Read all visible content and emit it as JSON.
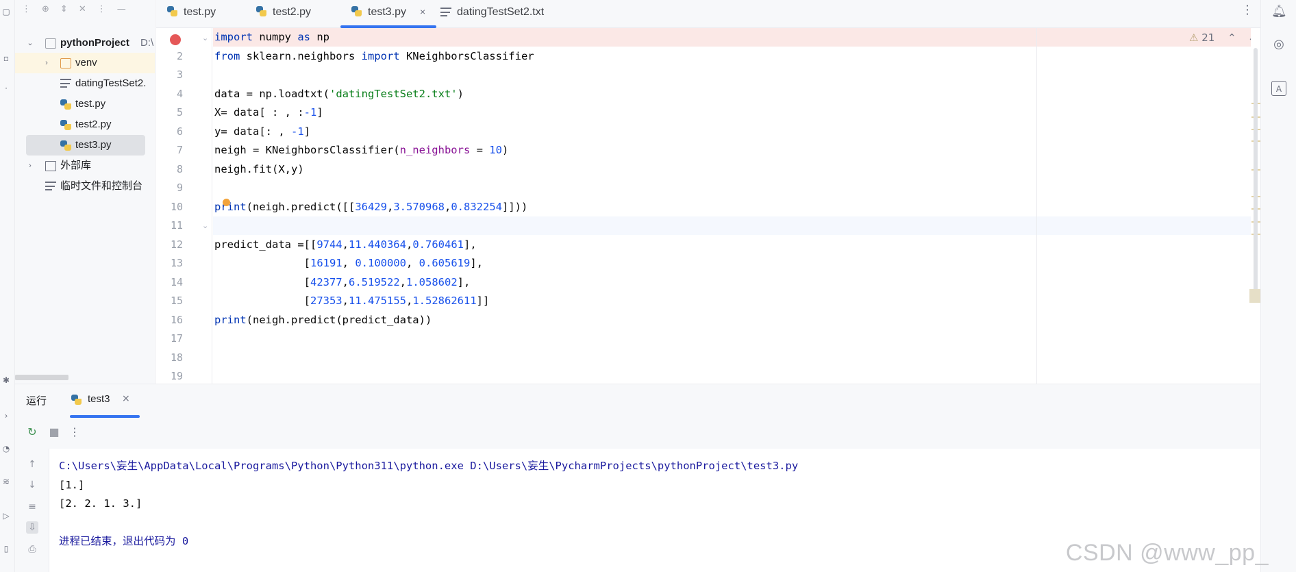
{
  "project_panel": {
    "toolbar_icons": [
      "ellipsis-icon",
      "target-icon",
      "expand-icon",
      "collapse-icon",
      "more-icon",
      "minimize-icon"
    ],
    "root": {
      "name": "pythonProject",
      "path": "D:\\"
    },
    "items": [
      {
        "label": "venv",
        "type": "folder"
      },
      {
        "label": "datingTestSet2.",
        "type": "text-file"
      },
      {
        "label": "test.py",
        "type": "python-file"
      },
      {
        "label": "test2.py",
        "type": "python-file"
      },
      {
        "label": "test3.py",
        "type": "python-file",
        "selected": true
      }
    ],
    "external_libs": "外部库",
    "scratches": "临时文件和控制台"
  },
  "tabs": [
    {
      "label": "test.py"
    },
    {
      "label": "test2.py"
    },
    {
      "label": "test3.py",
      "active": true,
      "close": "×"
    },
    {
      "label": "datingTestSet2.txt"
    }
  ],
  "tab_menu": "⋮",
  "inspection": {
    "warning_icon": "⚠",
    "count": "21",
    "up": "⌃",
    "down": "⌄"
  },
  "editor": {
    "line_numbers": [
      "2",
      "3",
      "4",
      "5",
      "6",
      "7",
      "8",
      "9",
      "10",
      "11",
      "12",
      "13",
      "14",
      "15",
      "16",
      "17",
      "18",
      "19"
    ],
    "lines": [
      {
        "segs": [
          {
            "t": "import",
            "c": "kw"
          },
          {
            "t": " numpy "
          },
          {
            "t": "as",
            "c": "kw"
          },
          {
            "t": " np"
          }
        ]
      },
      {
        "segs": [
          {
            "t": "from",
            "c": "kw"
          },
          {
            "t": " sklearn.neighbors "
          },
          {
            "t": "import",
            "c": "kw"
          },
          {
            "t": " KNeighborsClassifier"
          }
        ]
      },
      {
        "segs": []
      },
      {
        "segs": [
          {
            "t": "data = np.loadtxt("
          },
          {
            "t": "'datingTestSet2.txt'",
            "c": "str"
          },
          {
            "t": ")"
          }
        ]
      },
      {
        "segs": [
          {
            "t": "X= data[ : , :"
          },
          {
            "t": "-1",
            "c": "num"
          },
          {
            "t": "]"
          }
        ]
      },
      {
        "segs": [
          {
            "t": "y= data[: , "
          },
          {
            "t": "-1",
            "c": "num"
          },
          {
            "t": "]"
          }
        ]
      },
      {
        "segs": [
          {
            "t": "neigh = KNeighborsClassifier("
          },
          {
            "t": "n_neighbors",
            "c": "param"
          },
          {
            "t": " = "
          },
          {
            "t": "10",
            "c": "num"
          },
          {
            "t": ")"
          }
        ]
      },
      {
        "segs": [
          {
            "t": "neigh.fit(X,y)"
          }
        ]
      },
      {
        "segs": []
      },
      {
        "segs": [
          {
            "t": "print",
            "c": "kw"
          },
          {
            "t": "(neigh.predict([["
          },
          {
            "t": "36429",
            "c": "num"
          },
          {
            "t": ","
          },
          {
            "t": "3.570968",
            "c": "num"
          },
          {
            "t": ","
          },
          {
            "t": "0.832254",
            "c": "num"
          },
          {
            "t": "]]))"
          }
        ]
      },
      {
        "segs": []
      },
      {
        "segs": [
          {
            "t": "predict_data =[["
          },
          {
            "t": "9744",
            "c": "num"
          },
          {
            "t": ","
          },
          {
            "t": "11.440364",
            "c": "num"
          },
          {
            "t": ","
          },
          {
            "t": "0.760461",
            "c": "num"
          },
          {
            "t": "],"
          }
        ]
      },
      {
        "segs": [
          {
            "t": "              ["
          },
          {
            "t": "16191",
            "c": "num"
          },
          {
            "t": ", "
          },
          {
            "t": "0.100000",
            "c": "num"
          },
          {
            "t": ", "
          },
          {
            "t": "0.605619",
            "c": "num"
          },
          {
            "t": "],"
          }
        ]
      },
      {
        "segs": [
          {
            "t": "              ["
          },
          {
            "t": "42377",
            "c": "num"
          },
          {
            "t": ","
          },
          {
            "t": "6.519522",
            "c": "num"
          },
          {
            "t": ","
          },
          {
            "t": "1.058602",
            "c": "num"
          },
          {
            "t": "],"
          }
        ]
      },
      {
        "segs": [
          {
            "t": "              ["
          },
          {
            "t": "27353",
            "c": "num"
          },
          {
            "t": ","
          },
          {
            "t": "11.475155",
            "c": "num"
          },
          {
            "t": ","
          },
          {
            "t": "1.52862611",
            "c": "num"
          },
          {
            "t": "]]"
          }
        ]
      },
      {
        "segs": [
          {
            "t": "print",
            "c": "kw"
          },
          {
            "t": "(neigh.predict(predict_data))"
          }
        ]
      },
      {
        "segs": []
      },
      {
        "segs": []
      },
      {
        "segs": []
      }
    ]
  },
  "run_panel": {
    "title": "运行",
    "tab": {
      "label": "test3",
      "close": "×"
    },
    "console_lines": [
      {
        "text": "C:\\Users\\妄生\\AppData\\Local\\Programs\\Python\\Python311\\python.exe D:\\Users\\妄生\\PycharmProjects\\pythonProject\\test3.py",
        "kind": "path"
      },
      {
        "text": "[1.]",
        "kind": "out"
      },
      {
        "text": "[2. 2. 1. 3.]",
        "kind": "out"
      },
      {
        "text": "",
        "kind": "out"
      },
      {
        "text": "进程已结束，退出代码为 0",
        "kind": "done"
      }
    ]
  },
  "watermark": "CSDN @www_pp_",
  "colors": {
    "accent": "#3574f0",
    "keyword": "#0033b3",
    "string": "#067d17",
    "number": "#1750eb",
    "param": "#871094",
    "breakpoint": "#e55757"
  }
}
